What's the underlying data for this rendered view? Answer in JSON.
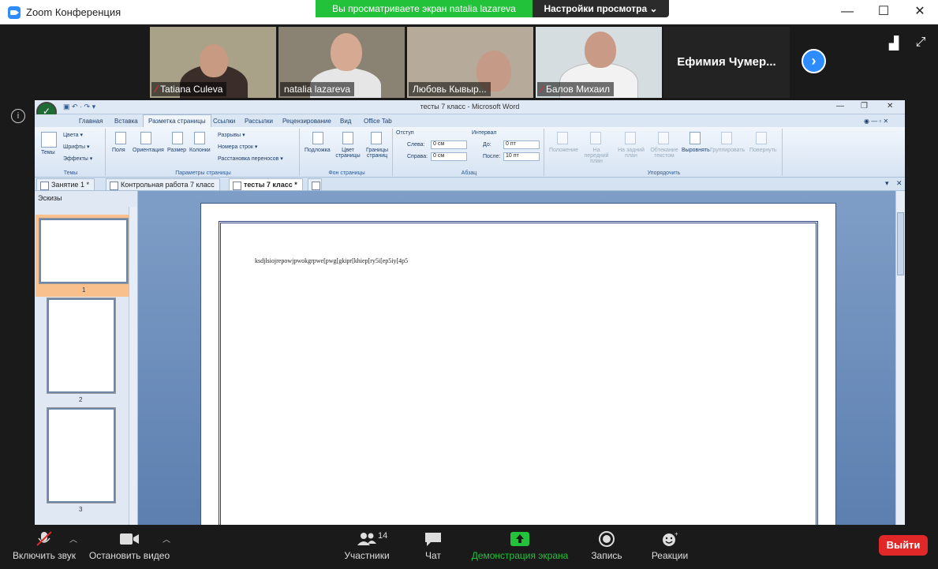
{
  "zoom": {
    "window_title": "Zoom Конференция",
    "banner": "Вы просматриваете экран natalia lazareva",
    "view_settings": "Настройки просмотра ⌄",
    "win_controls": {
      "minimize": "—",
      "maximize": "☐",
      "close": "✕"
    }
  },
  "participants": [
    {
      "name": "Tatiana Culeva",
      "muted": true,
      "bg": "#a9a188"
    },
    {
      "name": "natalia lazareva",
      "muted": false,
      "bg": "#8a8272"
    },
    {
      "name": "Любовь Кывыр...",
      "muted": false,
      "bg": "#b6ab9a"
    },
    {
      "name": "Балов Михаил",
      "muted": true,
      "bg": "#d6dde0"
    }
  ],
  "name_only_tile": "Ефимия  Чумер...",
  "word": {
    "title": "тесты 7 класс - Microsoft Word",
    "tabs": [
      "Главная",
      "Вставка",
      "Разметка страницы",
      "Ссылки",
      "Рассылки",
      "Рецензирование",
      "Вид",
      "Office Tab"
    ],
    "active_tab": "Разметка страницы",
    "groups": {
      "themes": {
        "label": "Темы",
        "themes_btn": "Темы",
        "colors": "Цвета ▾",
        "fonts": "Шрифты ▾",
        "effects": "Эффекты ▾"
      },
      "page_setup": {
        "label": "Параметры страницы",
        "fields": "Поля",
        "orientation": "Ориентация",
        "size": "Размер",
        "columns": "Колонки",
        "breaks": "Разрывы ▾",
        "line_numbers": "Номера строк ▾",
        "hyphenation": "Расстановка переносов ▾"
      },
      "background": {
        "label": "Фон страницы",
        "watermark": "Подложка",
        "page_color": "Цвет страницы",
        "borders": "Границы страниц"
      },
      "paragraph": {
        "label": "Абзац",
        "indent": "Отступ",
        "left": "Слева:",
        "left_val": "0 см",
        "right": "Справа:",
        "right_val": "0 см",
        "spacing": "Интервал",
        "before": "До:",
        "before_val": "0 пт",
        "after": "После:",
        "after_val": "10 пт"
      },
      "arrange": {
        "label": "Упорядочить",
        "position": "Положение",
        "front": "На передний план",
        "back": "На задний план",
        "wrap": "Обтекание текстом",
        "align": "Выровнять",
        "group": "Группировать",
        "rotate": "Повернуть"
      }
    },
    "doc_tabs": [
      "Занятие 1 *",
      "Контрольная работа  7 класс",
      "тесты 7 класс *"
    ],
    "thumbnails_label": "Эскизы",
    "thumb_numbers": [
      "1",
      "2",
      "3"
    ],
    "page_text": "ksdjlsiojrepowjpwokgrpwe[pwg[gkipr[khiep[ry5i[ep5iy[4p5"
  },
  "toolbar": {
    "unmute": "Включить звук",
    "video": "Остановить видео",
    "participants": "Участники",
    "participants_count": "14",
    "chat": "Чат",
    "share": "Демонстрация экрана",
    "record": "Запись",
    "reactions": "Реакции",
    "leave": "Выйти"
  }
}
